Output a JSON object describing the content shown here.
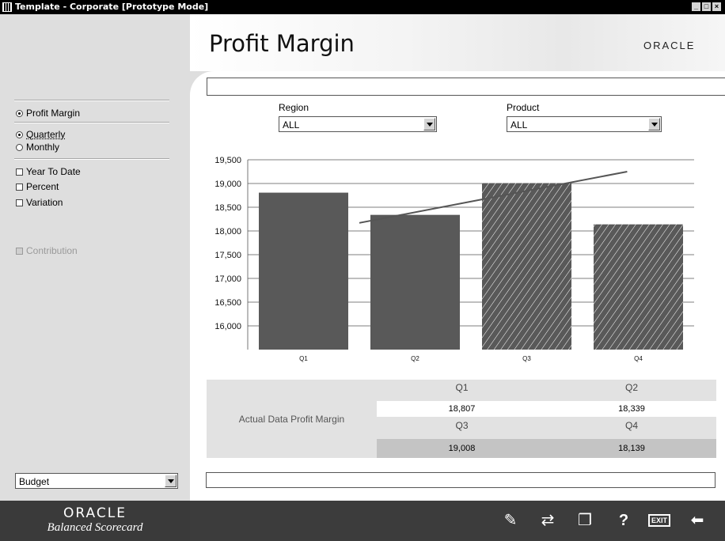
{
  "window": {
    "title": "Template - Corporate   [Prototype Mode]",
    "controls": [
      "_",
      "̹",
      "×"
    ]
  },
  "header": {
    "page_title": "Profit Margin",
    "logo": "ORACLE"
  },
  "sidebar": {
    "measure": {
      "label": "Profit Margin",
      "checked": true
    },
    "period": [
      {
        "label": "Quarterly",
        "checked": true
      },
      {
        "label": "Monthly",
        "checked": false
      }
    ],
    "options": [
      {
        "label": "Year To Date",
        "checked": false
      },
      {
        "label": "Percent",
        "checked": false
      },
      {
        "label": "Variation",
        "checked": false
      }
    ],
    "contribution": {
      "label": "Contribution",
      "enabled": false
    },
    "scenario_select": "Budget"
  },
  "filters": {
    "region_label": "Region",
    "region_value": "ALL",
    "product_label": "Product",
    "product_value": "ALL"
  },
  "chart_data": {
    "type": "bar",
    "categories": [
      "Q1",
      "Q2",
      "Q3",
      "Q4"
    ],
    "values": [
      18807,
      18339,
      19008,
      18139
    ],
    "hatched": [
      false,
      false,
      true,
      true
    ],
    "trend_line": {
      "x_start": 1.5,
      "y_start": 18170,
      "x_end": 3.9,
      "y_end": 19250
    },
    "ylim": [
      15500,
      19500
    ],
    "yticks": [
      "19,500",
      "19,000",
      "18,500",
      "18,000",
      "17,500",
      "17,000",
      "16,500",
      "16,000"
    ],
    "ytick_values": [
      19500,
      19000,
      18500,
      18000,
      17500,
      17000,
      16500,
      16000
    ],
    "grid": true,
    "colors": {
      "bar": "#595959",
      "hatch": "#ffffff",
      "line": "#555555"
    }
  },
  "table": {
    "row_label": "Actual Data Profit Margin",
    "headers_row1": [
      "Q1",
      "Q2"
    ],
    "values_row1": [
      "18,807",
      "18,339"
    ],
    "headers_row2": [
      "Q3",
      "Q4"
    ],
    "values_row2": [
      "19,008",
      "18,139"
    ]
  },
  "footer": {
    "brand": "ORACLE",
    "product": "Balanced Scorecard",
    "buttons": [
      {
        "name": "notes-icon",
        "glyph": "✎"
      },
      {
        "name": "refresh-icon",
        "glyph": "⇄"
      },
      {
        "name": "book-icon",
        "glyph": "❐"
      },
      {
        "name": "help-icon",
        "glyph": "?"
      },
      {
        "name": "exit-icon",
        "glyph": "EXIT"
      },
      {
        "name": "back-arrow-icon",
        "glyph": "⬅"
      }
    ]
  }
}
